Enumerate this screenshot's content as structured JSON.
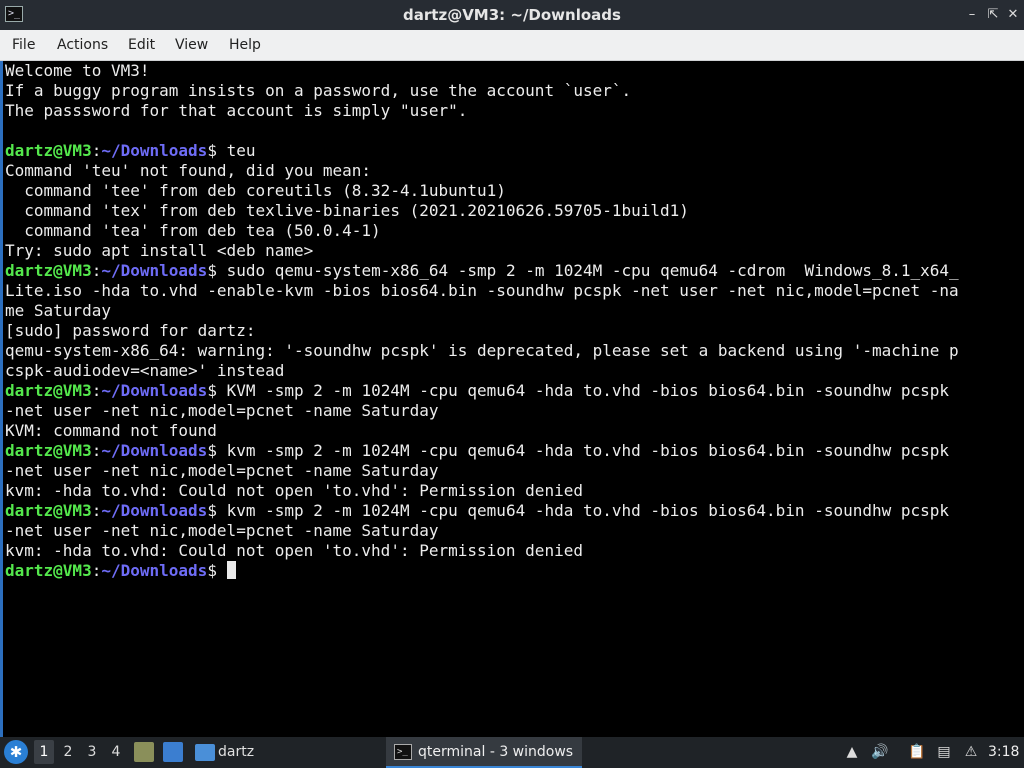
{
  "window": {
    "title": "dartz@VM3: ~/Downloads",
    "icon": "terminal-icon",
    "controls": [
      "minimize",
      "maximize",
      "close"
    ]
  },
  "menu": [
    "File",
    "Actions",
    "Edit",
    "View",
    "Help"
  ],
  "terminal": {
    "prompt_user": "dartz@VM3",
    "prompt_path": "~/Downloads",
    "lines": [
      {
        "text": "Welcome to VM3!"
      },
      {
        "text": "If a buggy program insists on a password, use the account `user`."
      },
      {
        "text": "The passsword for that account is simply \"user\"."
      },
      {
        "text": ""
      },
      {
        "prompt": true,
        "text": " teu"
      },
      {
        "text": "Command 'teu' not found, did you mean:"
      },
      {
        "text": "  command 'tee' from deb coreutils (8.32-4.1ubuntu1)"
      },
      {
        "text": "  command 'tex' from deb texlive-binaries (2021.20210626.59705-1build1)"
      },
      {
        "text": "  command 'tea' from deb tea (50.0.4-1)"
      },
      {
        "text": "Try: sudo apt install <deb name>"
      },
      {
        "prompt": true,
        "text": " sudo qemu-system-x86_64 -smp 2 -m 1024M -cpu qemu64 -cdrom  Windows_8.1_x64_"
      },
      {
        "text": "Lite.iso -hda to.vhd -enable-kvm -bios bios64.bin -soundhw pcspk -net user -net nic,model=pcnet -na"
      },
      {
        "text": "me Saturday"
      },
      {
        "text": "[sudo] password for dartz:"
      },
      {
        "text": "qemu-system-x86_64: warning: '-soundhw pcspk' is deprecated, please set a backend using '-machine p"
      },
      {
        "text": "cspk-audiodev=<name>' instead"
      },
      {
        "prompt": true,
        "text": " KVM -smp 2 -m 1024M -cpu qemu64 -hda to.vhd -bios bios64.bin -soundhw pcspk"
      },
      {
        "text": "-net user -net nic,model=pcnet -name Saturday"
      },
      {
        "text": "KVM: command not found"
      },
      {
        "prompt": true,
        "text": " kvm -smp 2 -m 1024M -cpu qemu64 -hda to.vhd -bios bios64.bin -soundhw pcspk"
      },
      {
        "text": "-net user -net nic,model=pcnet -name Saturday"
      },
      {
        "text": "kvm: -hda to.vhd: Could not open 'to.vhd': Permission denied"
      },
      {
        "prompt": true,
        "text": " kvm -smp 2 -m 1024M -cpu qemu64 -hda to.vhd -bios bios64.bin -soundhw pcspk"
      },
      {
        "text": "-net user -net nic,model=pcnet -name Saturday"
      },
      {
        "text": "kvm: -hda to.vhd: Could not open 'to.vhd': Permission denied"
      },
      {
        "prompt": true,
        "text": " ",
        "cursor": true
      }
    ]
  },
  "taskbar": {
    "workspaces": [
      "1",
      "2",
      "3",
      "4"
    ],
    "active_workspace": "1",
    "folder_label": "dartz",
    "task_label": "qterminal - 3 windows",
    "clock": "3:18",
    "tray_icons": [
      "notification-up-icon",
      "volume-icon",
      "clipboard-icon",
      "network-icon",
      "update-alert-icon"
    ]
  },
  "colors": {
    "prompt_user": "#54e84c",
    "prompt_path": "#6e6cf6",
    "terminal_bg": "#000000",
    "terminal_fg": "#ededed",
    "accent": "#2c6fbf"
  }
}
